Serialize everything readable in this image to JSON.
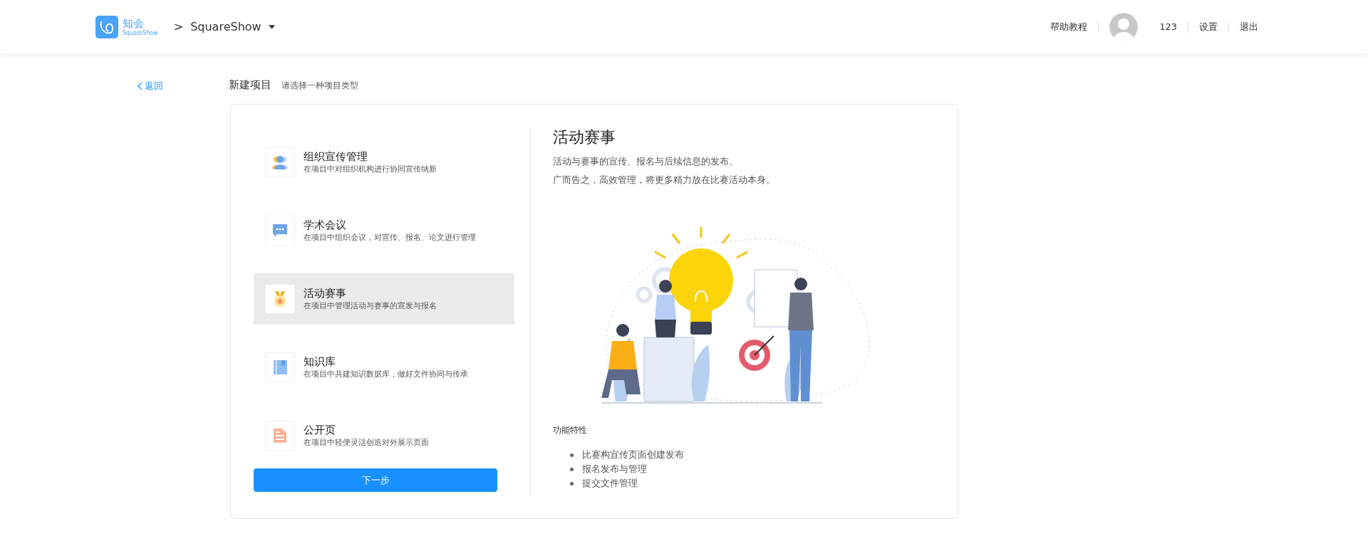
{
  "header": {
    "logo_text": "知会",
    "logo_subtext": "SquareShow",
    "breadcrumb_separator": ">",
    "workspace": "SquareShow",
    "help": "帮助教程",
    "username": "123",
    "settings": "设置",
    "logout": "退出"
  },
  "back_link": "返回",
  "page_title": "新建项目",
  "page_subtitle": "请选择一种项目类型",
  "project_types": [
    {
      "kind": "people",
      "title": "组织宣传管理",
      "description": "在项目中对组织机构进行协同宣传纳新",
      "selected": false
    },
    {
      "kind": "chat",
      "title": "学术会议",
      "description": "在项目中组织会议，对宣传、报名、论文进行管理",
      "selected": false
    },
    {
      "kind": "medal",
      "title": "活动赛事",
      "description": "在项目中管理活动与赛事的宣发与报名",
      "selected": true
    },
    {
      "kind": "book",
      "title": "知识库",
      "description": "在项目中共建知识数据库，做好文件协同与传承",
      "selected": false
    },
    {
      "kind": "document",
      "title": "公开页",
      "description": "在项目中轻便灵活创造对外展示页面",
      "selected": false
    }
  ],
  "next_button": "下一步",
  "detail": {
    "title": "活动赛事",
    "description_lines": [
      "活动与赛事的宣传、报名与后续信息的发布。",
      "广而告之，高效管理，将更多精力放在比赛活动本身。"
    ],
    "features_heading": "功能特性",
    "features": [
      "比赛构宣传页面创建发布",
      "报名发布与管理",
      "提交文件管理"
    ]
  }
}
